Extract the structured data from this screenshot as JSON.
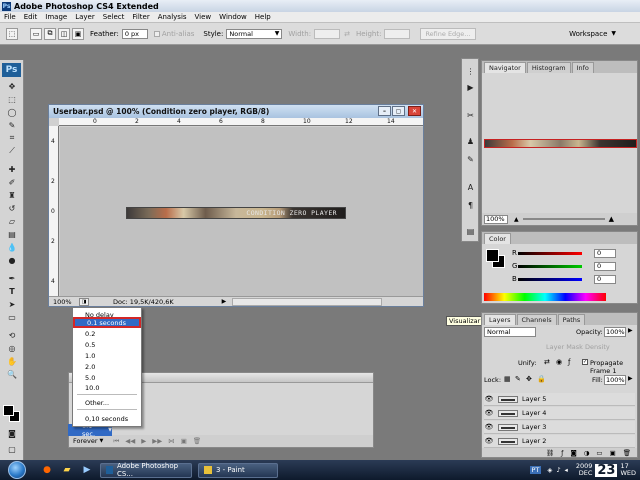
{
  "window": {
    "title": "Adobe Photoshop CS4 Extended"
  },
  "menu": [
    "File",
    "Edit",
    "Image",
    "Layer",
    "Select",
    "Filter",
    "Analysis",
    "View",
    "Window",
    "Help"
  ],
  "options": {
    "feather_label": "Feather:",
    "feather_value": "0 px",
    "antialias_label": "Anti-alias",
    "style_label": "Style:",
    "style_value": "Normal",
    "width_label": "Width:",
    "height_label": "Height:",
    "refine_edge": "Refine Edge...",
    "workspace_label": "Workspace"
  },
  "toolbox": {
    "logo": "Ps"
  },
  "document": {
    "title": "Userbar.psd @ 100% (Condition zero player, RGB/8)",
    "userbar_text": "CONDITION ZERO PLAYER",
    "hruler": [
      "0",
      "2",
      "4",
      "6",
      "8",
      "10",
      "12",
      "14"
    ],
    "vruler": [
      "4",
      "2",
      "0",
      "2",
      "4"
    ],
    "zoom": "100%",
    "doc_size": "Doc: 19,5K/420,6K"
  },
  "navigator": {
    "tabs": [
      "Navigator",
      "Histogram",
      "Info"
    ],
    "zoom": "100%"
  },
  "color": {
    "tab": "Color",
    "channels": [
      {
        "label": "R",
        "value": "0"
      },
      {
        "label": "G",
        "value": "0"
      },
      {
        "label": "B",
        "value": "0"
      }
    ]
  },
  "tooltip": "Visualizar",
  "layers": {
    "tabs": [
      "Layers",
      "Channels",
      "Paths"
    ],
    "blend_mode": "Normal",
    "opacity_label": "Opacity:",
    "opacity_value": "100%",
    "density_label": "Layer Mask Density",
    "unify_label": "Unify:",
    "propagate_label": "Propagate Frame 1",
    "lock_label": "Lock:",
    "fill_label": "Fill:",
    "fill_value": "100%",
    "items": [
      "Layer 5",
      "Layer 4",
      "Layer 3",
      "Layer 2"
    ]
  },
  "frame_delay_menu": {
    "items": [
      "No delay",
      "0.1 seconds",
      "0.2",
      "0.5",
      "1.0",
      "2.0",
      "5.0",
      "10.0",
      "Other...",
      "0,10 seconds"
    ],
    "selected": "0.1 seconds"
  },
  "animation": {
    "current_frame_delay": "0.1 sec.",
    "loop": "Forever"
  },
  "taskbar": {
    "tasks": [
      "Adobe Photoshop CS...",
      "3 - Paint"
    ],
    "lang": "PT",
    "date_month": "DEC",
    "date_year": "2009",
    "date_day": "23",
    "time": "17",
    "weekday": "WED"
  }
}
